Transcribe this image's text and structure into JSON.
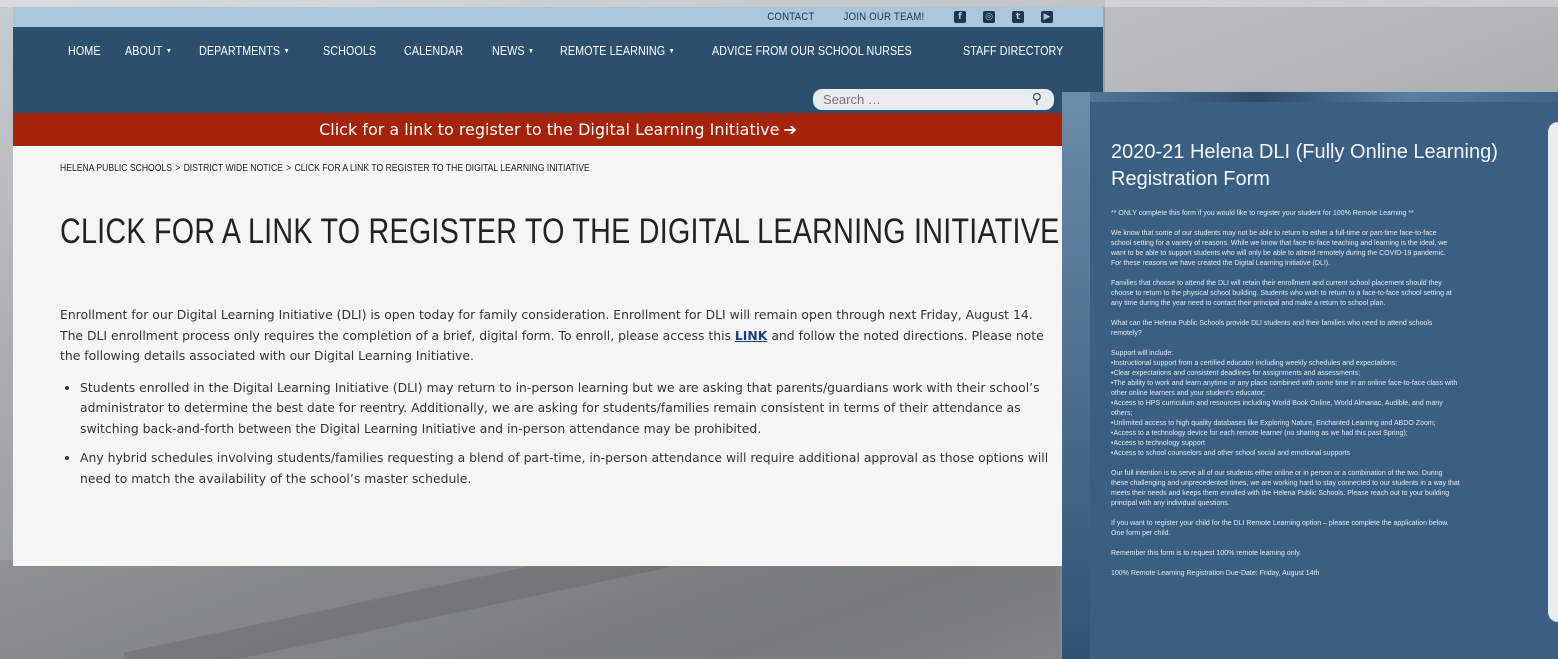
{
  "topbar": {
    "links": [
      "CONTACT",
      "JOIN OUR TEAM!"
    ],
    "social_icons": [
      "facebook-icon",
      "instagram-icon",
      "twitter-icon",
      "youtube-icon"
    ]
  },
  "nav": {
    "items": [
      {
        "label": "HOME",
        "dropdown": false
      },
      {
        "label": "ABOUT",
        "dropdown": true
      },
      {
        "label": "DEPARTMENTS",
        "dropdown": true
      },
      {
        "label": "SCHOOLS",
        "dropdown": false
      },
      {
        "label": "CALENDAR",
        "dropdown": false
      },
      {
        "label": "NEWS",
        "dropdown": true
      },
      {
        "label": "REMOTE LEARNING",
        "dropdown": true
      },
      {
        "label": "ADVICE FROM OUR SCHOOL NURSES",
        "dropdown": false
      },
      {
        "label": "STAFF DIRECTORY",
        "dropdown": false
      }
    ],
    "caret": "▼"
  },
  "search": {
    "placeholder": "Search …"
  },
  "banner": {
    "text": "Click for a link to register to the Digital Learning Initiative",
    "arrow": "➔"
  },
  "breadcrumb": {
    "items": [
      "HELENA PUBLIC SCHOOLS",
      "DISTRICT WIDE NOTICE",
      "CLICK FOR A LINK TO REGISTER TO THE DIGITAL LEARNING INITIATIVE"
    ],
    "separator": ">"
  },
  "page": {
    "title": "CLICK FOR A LINK TO REGISTER TO THE DIGITAL LEARNING INITIATIVE",
    "intro_before": "Enrollment for our Digital Learning Initiative (DLI) is open today for family consideration. Enrollment for DLI will remain open through next Friday, August 14. The DLI enrollment process only requires the completion of a brief, digital form. To enroll, please access this ",
    "intro_link": "LINK",
    "intro_after": " and follow the noted directions. Please note the following details associated with our Digital Learning Initiative.",
    "bullets": [
      "Students enrolled in the Digital Learning Initiative (DLI) may return to in-person learning but we are asking that parents/guardians work with their school’s administrator to determine the best date for reentry. Additionally, we are asking for students/families remain consistent in terms of their attendance as switching back-and-forth between the Digital Learning Initiative and in-person attendance may be prohibited.",
      "Any hybrid schedules involving students/families requesting a blend of part-time, in-person attendance will require additional approval as those options will need to match the availability of the school’s master schedule."
    ]
  },
  "form": {
    "title": "2020-21 Helena DLI (Fully Online Learning) Registration Form",
    "paragraphs": [
      [
        "** ONLY complete this form if you would like to register your student for 100% Remote Learning **"
      ],
      [
        "We know that some of our students may not be able to return to either a full-time or part-time face-to-face",
        "school setting for a variety of reasons.  While we know that face-to-face teaching and learning is the ideal, we",
        "want to be able to support students who will only be able to attend remotely during the COVID-19 pandemic.",
        "For these reasons we have created the Digital Learning Initiative (DLI)."
      ],
      [
        "Families that choose to attend the DLI will retain their enrollment and current school placement should they",
        "choose to return to the physical school building.  Students who wish to return to a face-to-face school setting at",
        "any time during the year need to contact their principal and make a return to school plan."
      ],
      [
        "What can the Helena Public Schools provide DLI students and their families who need to attend schools",
        "remotely?"
      ],
      [
        "Support will include:",
        "•Instructional support from a certified educator including weekly schedules and expectations;",
        "•Clear expectations and consistent deadlines for assignments and assessments;",
        "•The ability to work and learn anytime or any place combined with some time in an online face-to-face class with",
        "other online learners and your student's educator;",
        "•Access to HPS curriculum and resources including World Book Online, World Almanac, Audible, and many",
        "others;",
        "•Unlimited access to high quality databases like Exploring Nature, Enchanted Learning and ABDO Zoom;",
        "•Access to a technology device for each remote learner (no sharing as we had this past Spring);",
        "•Access to technology support",
        "•Access to school counselors and other school social and emotional supports"
      ],
      [
        "Our full intention is to serve all of our students either online or in person or a combination of the two.  During",
        "these challenging and unprecedented times, we are working hard to stay connected to our students in a way that",
        "meets their needs and keeps them enrolled with the Helena Public Schools. Please reach out to your building",
        "principal with any individual questions."
      ],
      [
        "If you want to register your child for the DLI Remote Learning option – please complete the application below.",
        "One form per child."
      ],
      [
        "Remember this form is to request 100% remote learning only."
      ],
      [
        "100% Remote Learning Registration Due-Date: Friday, August 14th"
      ]
    ]
  },
  "colors": {
    "topbar": "#a8c7dd",
    "navbar": "#2c4f6e",
    "banner": "#a4230a",
    "content_bg": "#f5f5f5",
    "form_bg": "#3a5f82",
    "link": "#1f3f7a"
  }
}
